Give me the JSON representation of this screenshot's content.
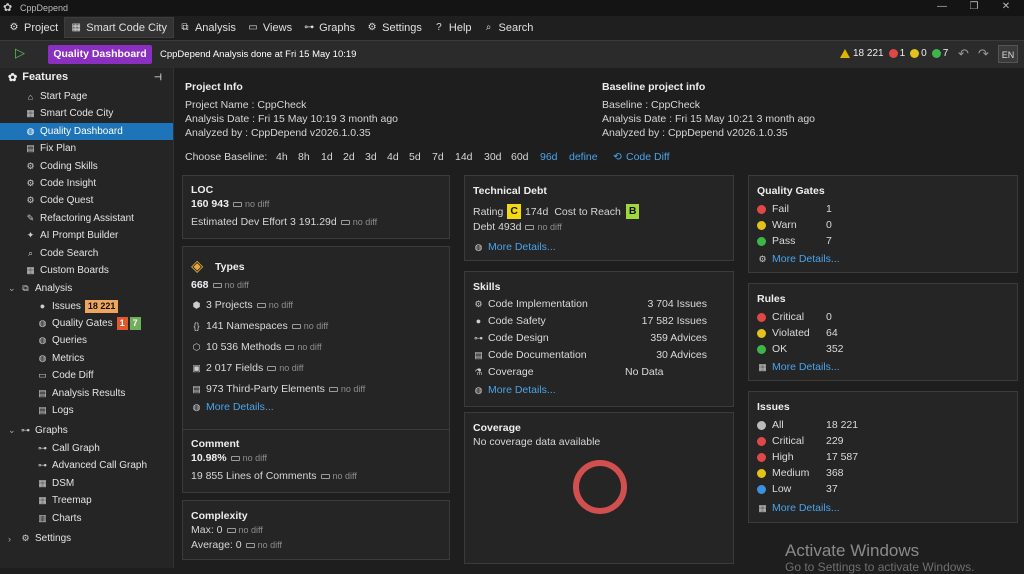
{
  "window": {
    "title": "CppDepend"
  },
  "menu": [
    {
      "label": "Project",
      "icon": "gear-icon",
      "glyph": "⚙"
    },
    {
      "label": "Smart Code City",
      "icon": "city-icon",
      "glyph": "▦"
    },
    {
      "label": "Analysis",
      "icon": "analysis-icon",
      "glyph": "⧉"
    },
    {
      "label": "Views",
      "icon": "views-icon",
      "glyph": "▭"
    },
    {
      "label": "Graphs",
      "icon": "graphs-icon",
      "glyph": "⊶"
    },
    {
      "label": "Settings",
      "icon": "settings-icon",
      "glyph": "⚙"
    },
    {
      "label": "Help",
      "icon": "help-icon",
      "glyph": "?"
    },
    {
      "label": "Search",
      "icon": "search-icon",
      "glyph": "⌕"
    }
  ],
  "toolbar": {
    "button": "Quality Dashboard",
    "status": "CppDepend Analysis done at Fri 15 May  10:19",
    "warn_count": "18 221",
    "red_count": "1",
    "yellow_count": "0",
    "green_count": "7",
    "lang": "EN",
    "colors": {
      "accent": "#8a2fbf",
      "selected": "#1e74b8"
    }
  },
  "sidebar": {
    "title": "Features",
    "items": [
      {
        "label": "Start Page",
        "icon": "home-icon",
        "glyph": "⌂"
      },
      {
        "label": "Smart Code City",
        "icon": "city-icon",
        "glyph": "▦"
      },
      {
        "label": "Quality Dashboard",
        "icon": "dashboard-icon",
        "glyph": "◍"
      },
      {
        "label": "Fix Plan",
        "icon": "fix-plan-icon",
        "glyph": "▤"
      },
      {
        "label": "Coding Skills",
        "icon": "skills-icon",
        "glyph": "⚙"
      },
      {
        "label": "Code Insight",
        "icon": "insight-icon",
        "glyph": "⚙"
      },
      {
        "label": "Code Quest",
        "icon": "quest-icon",
        "glyph": "⚙"
      },
      {
        "label": "Refactoring Assistant",
        "icon": "refactor-icon",
        "glyph": "✎"
      },
      {
        "label": "AI Prompt Builder",
        "icon": "ai-icon",
        "glyph": "✦"
      },
      {
        "label": "Code Search",
        "icon": "search-icon",
        "glyph": "⌕"
      },
      {
        "label": "Custom Boards",
        "icon": "boards-icon",
        "glyph": "▦"
      }
    ],
    "analysis": {
      "label": "Analysis",
      "items": [
        {
          "label": "Issues",
          "icon": "issues-icon",
          "glyph": "●",
          "badge": "18 221"
        },
        {
          "label": "Quality Gates",
          "icon": "quality-gates-icon",
          "glyph": "◍",
          "badge_red": "1",
          "badge_green": "7"
        },
        {
          "label": "Queries",
          "icon": "queries-icon",
          "glyph": "◍"
        },
        {
          "label": "Metrics",
          "icon": "metrics-icon",
          "glyph": "◍"
        },
        {
          "label": "Code Diff",
          "icon": "code-diff-icon",
          "glyph": "▭"
        },
        {
          "label": "Analysis Results",
          "icon": "results-icon",
          "glyph": "▤"
        },
        {
          "label": "Logs",
          "icon": "logs-icon",
          "glyph": "▤"
        }
      ]
    },
    "graphs": {
      "label": "Graphs",
      "items": [
        {
          "label": "Call Graph",
          "icon": "call-graph-icon",
          "glyph": "⊶"
        },
        {
          "label": "Advanced Call Graph",
          "icon": "adv-call-graph-icon",
          "glyph": "⊶"
        },
        {
          "label": "DSM",
          "icon": "dsm-icon",
          "glyph": "▦"
        },
        {
          "label": "Treemap",
          "icon": "treemap-icon",
          "glyph": "▦"
        },
        {
          "label": "Charts",
          "icon": "charts-icon",
          "glyph": "▥"
        }
      ]
    },
    "settings_label": "Settings"
  },
  "project_info": {
    "title": "Project Info",
    "name": "Project Name :  CppCheck",
    "date": "Analysis Date :  Fri 15 May  10:19 3 month ago",
    "by": "Analyzed by :    CppDepend v2026.1.0.35"
  },
  "baseline_info": {
    "title": "Baseline project info",
    "baseline": "Baseline :        CppCheck",
    "date": "Analysis Date : Fri 15 May  10:21 3 month ago",
    "by": "Analyzed by :    CppDepend v2026.1.0.35"
  },
  "choose_baseline": {
    "label": "Choose Baseline:",
    "options": [
      "4h",
      "8h",
      "1d",
      "2d",
      "3d",
      "4d",
      "5d",
      "7d",
      "14d",
      "30d",
      "60d",
      "96d",
      "define"
    ],
    "code_diff": "Code Diff"
  },
  "no_diff": "no diff",
  "more_details": "More Details...",
  "loc": {
    "title": "LOC",
    "value": "160 943",
    "effort": "Estimated Dev Effort 3 191.29d"
  },
  "types": {
    "title": "Types",
    "value": "668",
    "rows": [
      {
        "icon": "projects-icon",
        "glyph": "⬢",
        "text": "3 Projects"
      },
      {
        "icon": "namespaces-icon",
        "glyph": "{}",
        "text": "141 Namespaces"
      },
      {
        "icon": "methods-icon",
        "glyph": "⬡",
        "text": "10 536 Methods"
      },
      {
        "icon": "fields-icon",
        "glyph": "▣",
        "text": "2 017 Fields"
      },
      {
        "icon": "third-party-icon",
        "glyph": "▤",
        "text": "973 Third-Party Elements"
      }
    ]
  },
  "comment": {
    "title": "Comment",
    "value": "10.98%",
    "lines": "19 855 Lines of Comments"
  },
  "complexity": {
    "title": "Complexity",
    "max": "Max: 0",
    "avg": "Average: 0"
  },
  "tech_debt": {
    "title": "Technical Debt",
    "rating_label": "Rating",
    "rating": "C",
    "days": "174d",
    "cost_label": "Cost to Reach",
    "target": "B",
    "debt": "Debt 493d"
  },
  "skills": {
    "title": "Skills",
    "rows": [
      {
        "icon": "code-impl-icon",
        "glyph": "⚙",
        "label": "Code Implementation",
        "value": "3 704 Issues"
      },
      {
        "icon": "code-safety-icon",
        "glyph": "●",
        "label": "Code Safety",
        "value": "17 582 Issues"
      },
      {
        "icon": "code-design-icon",
        "glyph": "⊶",
        "label": "Code Design",
        "value": "359 Advices"
      },
      {
        "icon": "code-doc-icon",
        "glyph": "▤",
        "label": "Code Documentation",
        "value": "30 Advices"
      },
      {
        "icon": "coverage-icon",
        "glyph": "⚗",
        "label": "Coverage",
        "value": "No Data"
      }
    ]
  },
  "coverage": {
    "title": "Coverage",
    "text": "No coverage data available"
  },
  "quality_gates": {
    "title": "Quality Gates",
    "rows": [
      {
        "icon": "fail-icon",
        "label": "Fail",
        "value": "1",
        "color": "#e04848"
      },
      {
        "icon": "warn-icon",
        "label": "Warn",
        "value": "0",
        "color": "#e2c21b"
      },
      {
        "icon": "pass-icon",
        "label": "Pass",
        "value": "7",
        "color": "#3db54a"
      }
    ]
  },
  "rules": {
    "title": "Rules",
    "rows": [
      {
        "icon": "critical-icon",
        "label": "Critical",
        "value": "0",
        "color": "#e04848"
      },
      {
        "icon": "violated-icon",
        "label": "Violated",
        "value": "64",
        "color": "#e2c21b"
      },
      {
        "icon": "ok-icon",
        "label": "OK",
        "value": "352",
        "color": "#3db54a"
      }
    ]
  },
  "issues": {
    "title": "Issues",
    "rows": [
      {
        "icon": "all-icon",
        "label": "All",
        "value": "18 221",
        "color": "#bbbbbb"
      },
      {
        "icon": "critical-icon",
        "label": "Critical",
        "value": "229",
        "color": "#e04848"
      },
      {
        "icon": "high-icon",
        "label": "High",
        "value": "17 587",
        "color": "#e04848"
      },
      {
        "icon": "medium-icon",
        "label": "Medium",
        "value": "368",
        "color": "#e2c21b"
      },
      {
        "icon": "low-icon",
        "label": "Low",
        "value": "37",
        "color": "#3d8fe0"
      }
    ]
  },
  "watermark": {
    "title": "Activate Windows",
    "sub": "Go to Settings to activate Windows."
  }
}
